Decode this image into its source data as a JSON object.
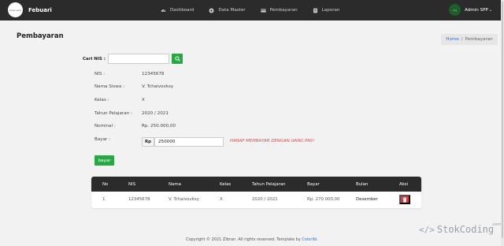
{
  "navbar": {
    "brand_name": "Febuari",
    "logo_text": "jones oper",
    "items": [
      {
        "label": "Dashboard",
        "icon": "speedometer-icon"
      },
      {
        "label": "Data Master",
        "icon": "dotcircle-icon"
      },
      {
        "label": "Pembayaran",
        "icon": "card-icon"
      },
      {
        "label": "Laporan",
        "icon": "report-icon"
      }
    ],
    "user": {
      "name": "Admin SPP",
      "avatar_text": "oog"
    }
  },
  "page": {
    "title": "Pembayaran",
    "breadcrumb": {
      "home": "Home",
      "separator": "/",
      "current": "Pembayaran"
    }
  },
  "search": {
    "label": "Cari NIS :",
    "value": "",
    "placeholder": ""
  },
  "student": {
    "rows": [
      {
        "label": "NIS :",
        "value": "12345678"
      },
      {
        "label": "Nama Siswa :",
        "value": "V. Tchaivovksy"
      },
      {
        "label": "Kelas :",
        "value": "X"
      },
      {
        "label": "Tahun Pelajaran :",
        "value": "2020 / 2021"
      },
      {
        "label": "Nominal :",
        "value": "Rp. 250.000,00"
      }
    ]
  },
  "payment": {
    "label": "Bayar :",
    "currency_label": "Rp",
    "amount": "250000",
    "warning": "HARAP MEMBAYAR DENGAN UANG PAS!",
    "button_label": "bayar"
  },
  "table": {
    "headers": [
      "No",
      "NIS",
      "Nama",
      "Kelas",
      "Tahun Pelajaran",
      "Bayar",
      "Bulan",
      "Aksi"
    ],
    "rows": [
      {
        "no": "1",
        "nis": "12345678",
        "nama": "V. Tchaivovksy",
        "kelas": "X",
        "tahun": "2020 / 2021",
        "bayar": "Rp. 270.000,00",
        "bulan": "Desember"
      }
    ]
  },
  "footer": {
    "text": "Copyright © 2021 Zibran. All rights reserved. Template by",
    "link": "Colorlib."
  },
  "watermark": {
    "code": "</>",
    "text": "StokCoding",
    "suffix": ".com"
  },
  "colors": {
    "navbar": "#2b2b2b",
    "success": "#28a745",
    "danger": "#dc3545",
    "warning": "#d9534f",
    "link": "#2a6fdb",
    "background": "#f2f2f2"
  }
}
